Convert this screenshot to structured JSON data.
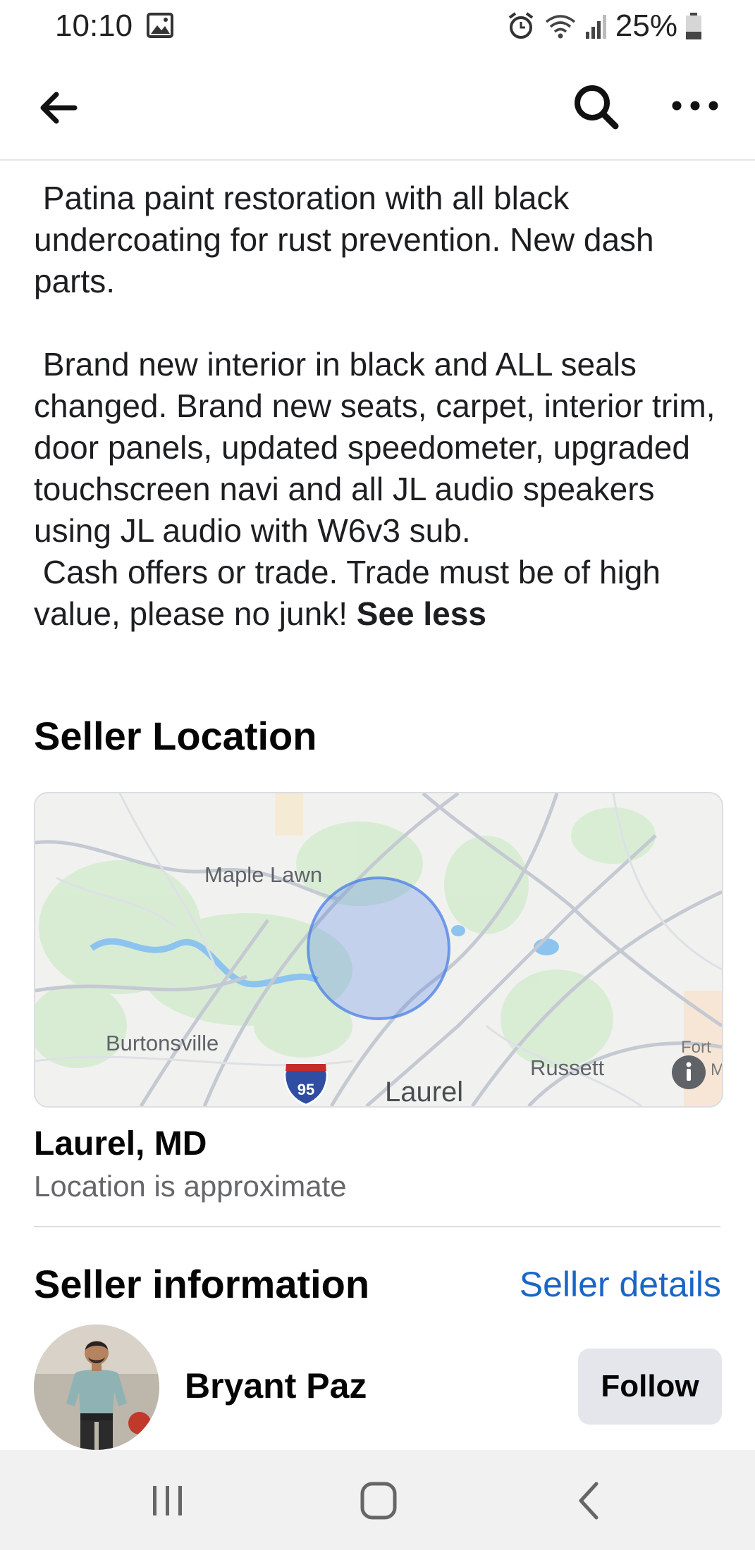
{
  "status_bar": {
    "time": "10:10",
    "battery": "25%",
    "icons": [
      "gallery-icon",
      "alarm-icon",
      "wifi-icon",
      "signal-icon",
      "battery-icon"
    ]
  },
  "top_nav": {
    "icons": [
      "back-arrow-icon",
      "search-icon",
      "more-options-icon"
    ]
  },
  "description": {
    "text": " Patina paint restoration with all black undercoating for rust prevention. New dash parts.\n\n Brand new interior in black and ALL seals changed. Brand new seats, carpet, interior trim, door panels, updated speedometer, upgraded touchscreen navi and all JL audio speakers using JL audio with W6v3 sub.\n Cash offers or trade. Trade must be of high value, please no junk! ",
    "see_less": "See less"
  },
  "seller_location": {
    "title": "Seller Location",
    "map_labels": {
      "maple_lawn": "Maple Lawn",
      "burtonsville": "Burtonsville",
      "laurel": "Laurel",
      "russett": "Russett",
      "fort": "Fort",
      "fort_suffix": "M",
      "interstate": "95"
    },
    "location_name": "Laurel, MD",
    "location_note": "Location is approximate"
  },
  "seller_information": {
    "title": "Seller information",
    "details_link": "Seller details",
    "seller_name": "Bryant Paz",
    "follow_label": "Follow"
  },
  "colors": {
    "link_blue": "#1a66c7",
    "map_circle": "#4a7fe6",
    "follow_bg": "#e4e6eb"
  }
}
